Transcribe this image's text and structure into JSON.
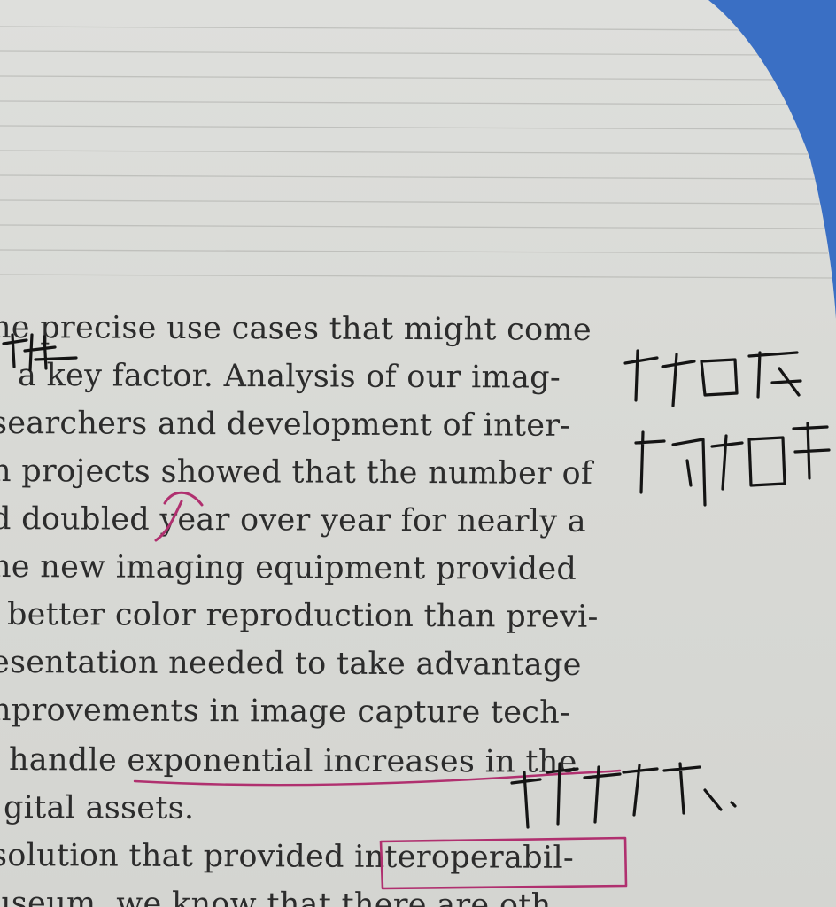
{
  "lines": [
    "he precise use cases that might come",
    "a key factor. Analysis of our imag-",
    "searchers and development of inter-",
    "n projects showed that the number of",
    "d doubled year over year for nearly a",
    "he new imaging equipment provided",
    "better color reproduction than previ-",
    "esentation needed to take advantage",
    "nprovements in image capture tech-",
    "handle exponential increases in the",
    "gital assets.",
    "solution that provided interoperabil-",
    "useum, we know that there are oth"
  ],
  "colors": {
    "paper": "#dcddd9",
    "background": "#3a6fc4",
    "ink_text": "#2c2c2c",
    "pen_black": "#141414",
    "pen_magenta": "#b0306f"
  }
}
